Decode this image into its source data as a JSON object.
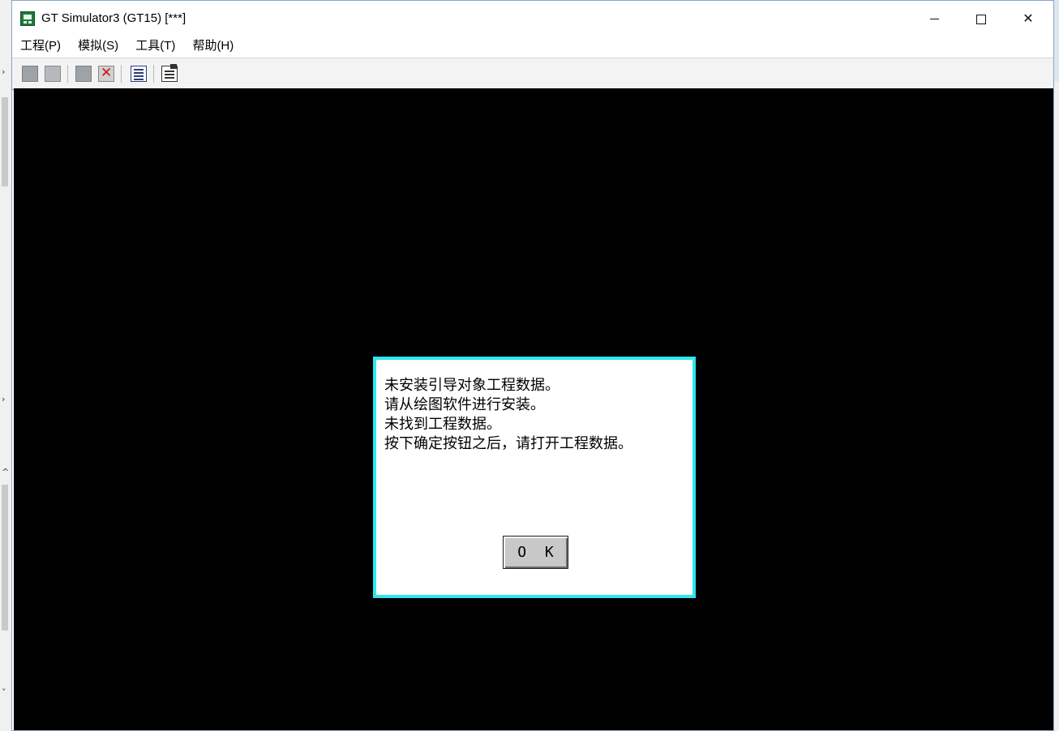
{
  "window": {
    "title": "GT Simulator3 (GT15)  [***]",
    "minimize_symbol": "",
    "maximize_symbol": "",
    "close_symbol": "✕"
  },
  "menu": {
    "items": [
      "工程(P)",
      "模拟(S)",
      "工具(T)",
      "帮助(H)"
    ]
  },
  "toolbar": {
    "icons": [
      "open-project-icon",
      "open-folder-icon",
      "start-simulation-icon",
      "stop-simulation-icon",
      "device-monitor-icon",
      "option-settings-icon"
    ]
  },
  "background_strip": {
    "marks": [
      "›",
      "›",
      "›",
      "‹",
      "‹",
      "^",
      "˅"
    ]
  },
  "dialog": {
    "lines": [
      "未安装引导对象工程数据。",
      "请从绘图软件进行安装。",
      "未找到工程数据。",
      "按下确定按钮之后，请打开工程数据。"
    ],
    "ok_label": "O K"
  },
  "colors": {
    "screen_background": "#000000",
    "dialog_border": "#2fe6ee",
    "window_border": "#8aa4c4"
  }
}
